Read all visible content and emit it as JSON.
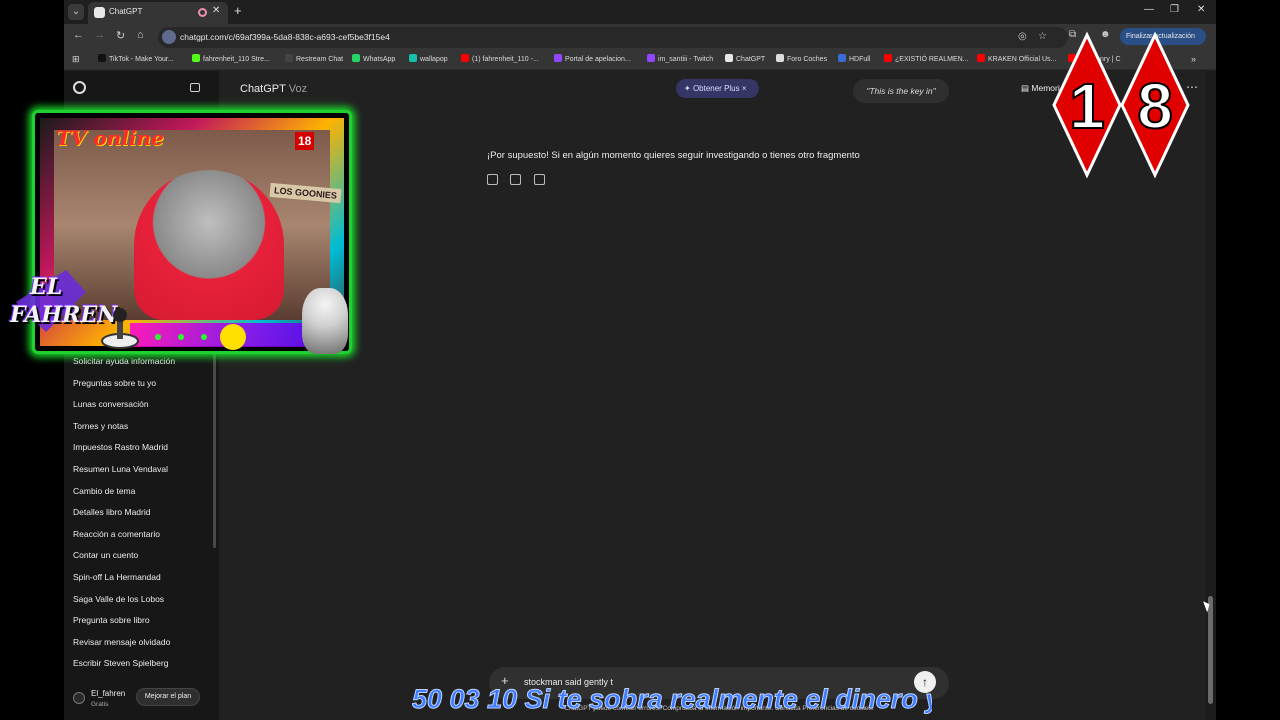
{
  "browser": {
    "tab_title": "ChatGPT",
    "url": "chatgpt.com/c/69af399a-5da8-838c-a693-cef5be3f15e4",
    "update_label": "Finalizar actualización",
    "bookmarks": [
      {
        "label": "TikTok - Make Your...",
        "color": "#111111"
      },
      {
        "label": "fahrenheit_110 Stre...",
        "color": "#53fc18"
      },
      {
        "label": "Restream Chat",
        "color": "#444444"
      },
      {
        "label": "WhatsApp",
        "color": "#25d366"
      },
      {
        "label": "wallapop",
        "color": "#13c1ac"
      },
      {
        "label": "(1) fahrenheit_110 -...",
        "color": "#ff0000"
      },
      {
        "label": "Portal de apelacion...",
        "color": "#9146ff"
      },
      {
        "label": "im_santiii - Twitch",
        "color": "#9146ff"
      },
      {
        "label": "ChatGPT",
        "color": "#e8e8e8"
      },
      {
        "label": "Foro Coches",
        "color": "#dddddd"
      },
      {
        "label": "HDFull",
        "color": "#3b6bd6"
      },
      {
        "label": "¿EXISTIÓ REALMEN...",
        "color": "#ff0000"
      },
      {
        "label": "KRAKEN Official Us...",
        "color": "#ff0000"
      },
      {
        "label": "ore Henry | C",
        "color": "#ff0000"
      }
    ]
  },
  "sidebar": {
    "items": [
      "Solicitar ayuda información",
      "Preguntas sobre tu yo",
      "Lunas conversación",
      "Tornes y notas",
      "Impuestos Rastro Madrid",
      "Resumen Luna Vendaval",
      "Cambio de tema",
      "Detalles libro Madrid",
      "Reacción a comentario",
      "Contar un cuento",
      "Spin-off La Hermandad",
      "Saga Valle de los Lobos",
      "Pregunta sobre libro",
      "Revisar mensaje olvidado",
      "Escribir Steven Spielberg"
    ],
    "user_name": "El_fahren",
    "user_plan": "Gratis",
    "upgrade_label": "Mejorar el plan"
  },
  "main": {
    "title_app": "ChatGPT",
    "title_mode": "Voz",
    "plus_label": "Obtener Plus",
    "quote": "\"This is the key in\"",
    "memory_label": "Memori",
    "message": "¡Por supuesto! Si en algún momento quieres seguir investigando o tienes otro fragmento",
    "composer_text": "stockman said gently t",
    "disclaimer": "ChatGPT puede cometer errores. Comprueba la información importante. Consulta Preferencias de cookies."
  },
  "overlay": {
    "webcam_logo": "TV online",
    "webcam_poster": "LOS GOONIES",
    "webcam_age": "18",
    "brand_line1": "EL",
    "brand_line2": "FAHREN",
    "age_digit1": "1",
    "age_digit2": "8",
    "ticker": "50 03 10 Si te sobra realmente el dinero y"
  }
}
